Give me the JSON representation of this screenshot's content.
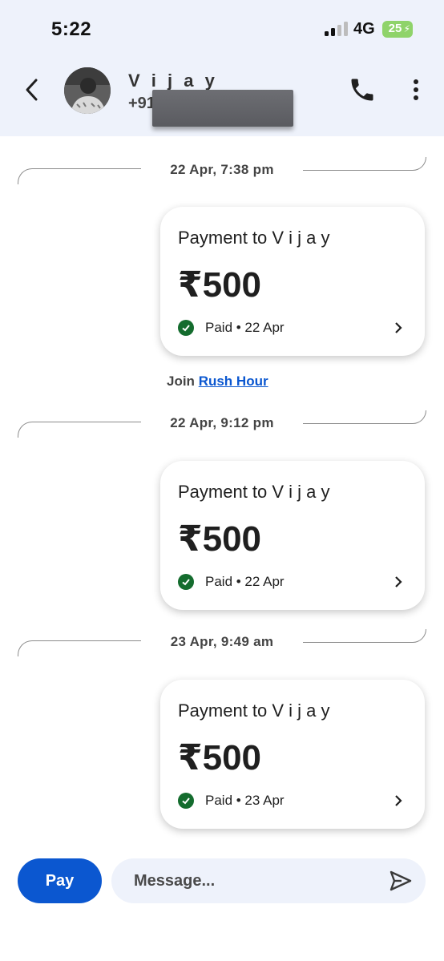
{
  "status_bar": {
    "time": "5:22",
    "network": "4G",
    "battery": "25"
  },
  "header": {
    "contact_name": "V i j a y",
    "phone_prefix": "+91"
  },
  "date_labels": [
    "22 Apr, 7:38 pm",
    "22 Apr, 9:12 pm",
    "23 Apr, 9:49 am"
  ],
  "payments": [
    {
      "title": "Payment to V i j a y",
      "amount": "₹500",
      "status": "Paid • 22 Apr"
    },
    {
      "title": "Payment to V i j a y",
      "amount": "₹500",
      "status": "Paid • 22 Apr"
    },
    {
      "title": "Payment to V i j a y",
      "amount": "₹500",
      "status": "Paid • 23 Apr"
    }
  ],
  "promo": {
    "prefix": "Join",
    "link": "Rush Hour"
  },
  "composer": {
    "pay_label": "Pay",
    "placeholder": "Message..."
  },
  "colors": {
    "accent": "#0b57d0",
    "paid_green": "#146c2e",
    "header_bg": "#eef2fb"
  }
}
